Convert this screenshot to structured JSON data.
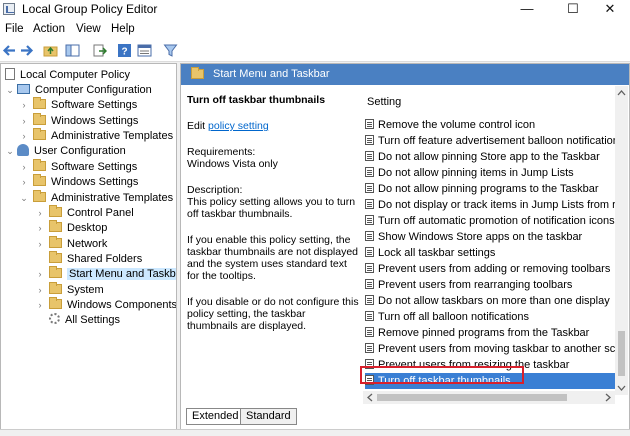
{
  "window": {
    "title": "Local Group Policy Editor",
    "controls": [
      "—",
      "☐",
      "✕"
    ]
  },
  "menu": [
    "File",
    "Action",
    "View",
    "Help"
  ],
  "toolbar_icons": [
    "back-arrow-icon",
    "forward-arrow-icon",
    "up-folder-icon",
    "show-hide-tree-icon",
    "export-list-icon",
    "help-icon",
    "properties-icon",
    "filter-icon"
  ],
  "tree": [
    {
      "label": "Local Computer Policy",
      "icon": "doc",
      "indent": 0,
      "arrow": ""
    },
    {
      "label": "Computer Configuration",
      "icon": "pc",
      "indent": 1,
      "arrow": "⌄"
    },
    {
      "label": "Software Settings",
      "icon": "folder",
      "indent": 2,
      "arrow": "›"
    },
    {
      "label": "Windows Settings",
      "icon": "folder",
      "indent": 2,
      "arrow": "›"
    },
    {
      "label": "Administrative Templates",
      "icon": "folder",
      "indent": 2,
      "arrow": "›"
    },
    {
      "label": "User Configuration",
      "icon": "user",
      "indent": 1,
      "arrow": "⌄"
    },
    {
      "label": "Software Settings",
      "icon": "folder",
      "indent": 2,
      "arrow": "›"
    },
    {
      "label": "Windows Settings",
      "icon": "folder",
      "indent": 2,
      "arrow": "›"
    },
    {
      "label": "Administrative Templates",
      "icon": "folder",
      "indent": 2,
      "arrow": "⌄"
    },
    {
      "label": "Control Panel",
      "icon": "folder",
      "indent": 3,
      "arrow": "›"
    },
    {
      "label": "Desktop",
      "icon": "folder",
      "indent": 3,
      "arrow": "›"
    },
    {
      "label": "Network",
      "icon": "folder",
      "indent": 3,
      "arrow": "›"
    },
    {
      "label": "Shared Folders",
      "icon": "folder",
      "indent": 3,
      "arrow": ""
    },
    {
      "label": "Start Menu and Taskbar",
      "icon": "folder",
      "indent": 3,
      "arrow": "›",
      "selected": true
    },
    {
      "label": "System",
      "icon": "folder",
      "indent": 3,
      "arrow": "›"
    },
    {
      "label": "Windows Components",
      "icon": "folder",
      "indent": 3,
      "arrow": "›"
    },
    {
      "label": "All Settings",
      "icon": "gear",
      "indent": 3,
      "arrow": ""
    }
  ],
  "panel": {
    "header": "Start Menu and Taskbar",
    "policy_title": "Turn off taskbar thumbnails",
    "edit_prefix": "Edit",
    "edit_link": "policy setting",
    "requirements_label": "Requirements:",
    "requirements_value": "Windows Vista only",
    "description_label": "Description:",
    "description_text": "This policy setting allows you to turn off taskbar thumbnails.",
    "if_enable_text": "If you enable this policy setting, the taskbar thumbnails are not displayed and the system uses standard text for the tooltips.",
    "if_disable_text": "If you disable or do not configure this policy setting, the taskbar thumbnails are displayed."
  },
  "settings": {
    "column_header": "Setting",
    "rows": [
      "Remove the volume control icon",
      "Turn off feature advertisement balloon notifications",
      "Do not allow pinning Store app to the Taskbar",
      "Do not allow pinning items in Jump Lists",
      "Do not allow pinning programs to the Taskbar",
      "Do not display or track items in Jump Lists from remo",
      "Turn off automatic promotion of notification icons to",
      "Show Windows Store apps on the taskbar",
      "Lock all taskbar settings",
      "Prevent users from adding or removing toolbars",
      "Prevent users from rearranging toolbars",
      "Do not allow taskbars on more than one display",
      "Turn off all balloon notifications",
      "Remove pinned programs from the Taskbar",
      "Prevent users from moving taskbar to another screen",
      "Prevent users from resizing the taskbar",
      "Turn off taskbar thumbnails"
    ],
    "selected_index": 16
  },
  "tabs": [
    "Extended",
    "Standard"
  ],
  "colors": {
    "header_blue": "#4a80c2",
    "selection_blue": "#3a7fd4",
    "highlight_red": "#d8202c",
    "link_blue": "#0066cc"
  }
}
